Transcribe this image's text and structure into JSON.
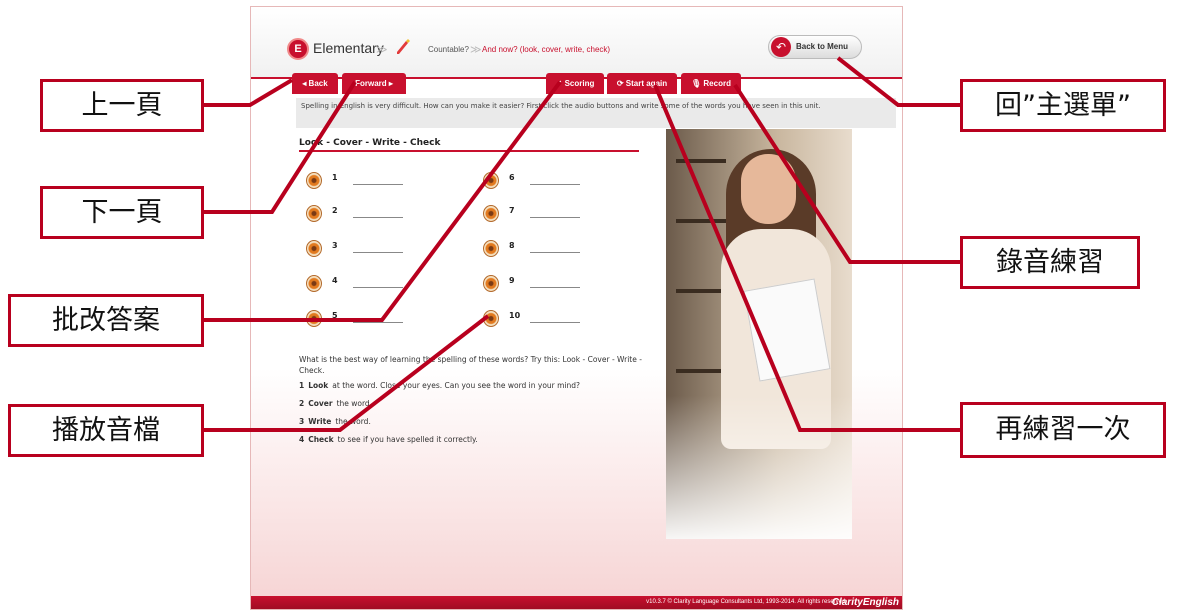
{
  "header": {
    "level_badge": "E",
    "level": "Elementary",
    "separator": "≫",
    "crumb1": "Countable?",
    "crumb2": "And now? (look, cover, write, check)",
    "menu_button": "Back to Menu"
  },
  "toolbar": {
    "back": "◂ Back",
    "forward": "Forward ▸",
    "scoring": "✓ Scoring",
    "start_again": "⟳ Start again",
    "record": "🎙 Record"
  },
  "intro": "Spelling in English is very difficult. How can you make it easier? First click the audio buttons and write some of the words you have seen in this unit.",
  "section_title": "Look - Cover - Write - Check",
  "items": [
    "1",
    "2",
    "3",
    "4",
    "5",
    "6",
    "7",
    "8",
    "9",
    "10"
  ],
  "instructions": "What is the best way of learning the spelling of these words? Try this: Look - Cover - Write - Check.",
  "steps": [
    {
      "num": "1",
      "bold": "Look",
      "text": "at the word. Close your eyes. Can you see the word in your mind?"
    },
    {
      "num": "2",
      "bold": "Cover",
      "text": "the word."
    },
    {
      "num": "3",
      "bold": "Write",
      "text": "the word."
    },
    {
      "num": "4",
      "bold": "Check",
      "text": "to see if you have spelled it correctly."
    }
  ],
  "footer": {
    "copyright": "v10.3.7 © Clarity Language Consultants Ltd, 1993-2014. All rights reserved.",
    "brand": "ClarityEnglish"
  },
  "callouts": {
    "back": "上一頁",
    "forward": "下一頁",
    "scoring": "批改答案",
    "audio": "播放音檔",
    "menu": "回”主選單”",
    "record": "錄音練習",
    "start_again": "再練習一次"
  },
  "colors": {
    "accent": "#c8102e",
    "callout_border": "#b8001e"
  }
}
